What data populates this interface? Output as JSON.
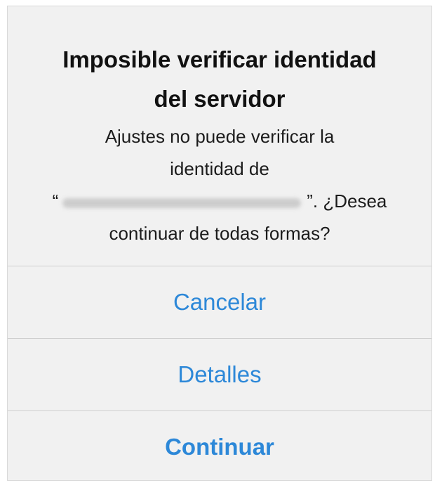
{
  "alert": {
    "title_line1": "Imposible verificar identidad",
    "title_line2": "del servidor",
    "message": {
      "line1": "Ajustes no puede verificar la",
      "line2": "identidad de",
      "quote_open": "“",
      "line3_after": "”. ¿Desea",
      "line4": "continuar de todas formas?"
    },
    "buttons": {
      "cancel": "Cancelar",
      "details": "Detalles",
      "continue": "Continuar"
    },
    "colors": {
      "background": "#f1f1f1",
      "button_text": "#2d88d8",
      "divider": "#cfcfcf"
    }
  }
}
